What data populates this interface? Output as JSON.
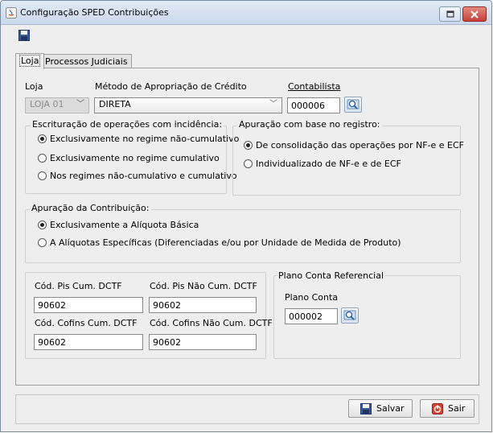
{
  "window": {
    "title": "Configuração SPED Contribuições",
    "minimize_label": "▫",
    "close_label": "✕"
  },
  "tabs": [
    {
      "label": "Loja"
    },
    {
      "label": "Processos Judiciais"
    }
  ],
  "loja": {
    "loja_label": "Loja",
    "loja_value": "LOJA 01",
    "metodo_label": "Método de Apropriação de Crédito",
    "metodo_value": "DIRETA",
    "contabilista_label": "Contabilista",
    "contabilista_value": "000006"
  },
  "escrituracao": {
    "title": "Escrituração de operações com incidência:",
    "options": [
      {
        "label": "Exclusivamente no regime não-cumulativo",
        "selected": true
      },
      {
        "label": "Exclusivamente no regime cumulativo",
        "selected": false
      },
      {
        "label": "Nos regimes não-cumulativo e cumulativo",
        "selected": false
      }
    ]
  },
  "apuracao_registro": {
    "title": "Apuração com base no registro:",
    "options": [
      {
        "label": "De consolidação das operações por NF-e e ECF",
        "selected": true
      },
      {
        "label": "Individualizado de NF-e e de ECF",
        "selected": false
      }
    ]
  },
  "apuracao_contribuicao": {
    "title": "Apuração da Contribuição:",
    "options": [
      {
        "label": "Exclusivamente a Alíquota Básica",
        "selected": true
      },
      {
        "label": "A Alíquotas Específicas (Diferenciadas e/ou por Unidade de Medida de Produto)",
        "selected": false
      }
    ]
  },
  "dctf": {
    "pis_cum_label": "Cód. Pis Cum. DCTF",
    "pis_cum_value": "90602",
    "pis_nao_cum_label": "Cód. Pis Não Cum. DCTF",
    "pis_nao_cum_value": "90602",
    "cofins_cum_label": "Cód. Cofins Cum. DCTF",
    "cofins_cum_value": "90602",
    "cofins_nao_cum_label": "Cód. Cofins Não Cum. DCTF",
    "cofins_nao_cum_value": "90602"
  },
  "plano_conta": {
    "title": "Plano Conta Referencial",
    "label": "Plano Conta",
    "value": "000002"
  },
  "footer": {
    "salvar_label": "Salvar",
    "sair_label": "Sair"
  },
  "colors": {
    "titlebar": "#c9d8ec",
    "close_button": "#c8403a",
    "sair_icon": "#d94030"
  }
}
